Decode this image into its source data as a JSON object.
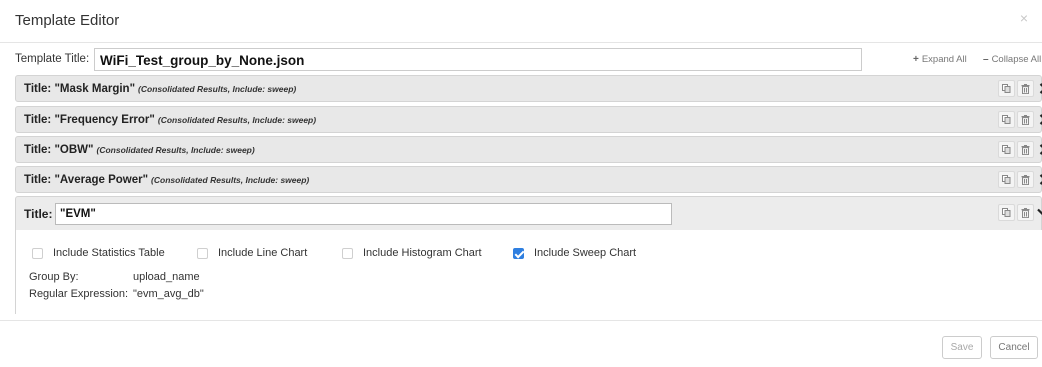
{
  "modal": {
    "title": "Template Editor",
    "close_glyph": "×"
  },
  "template_title": {
    "label": "Template Title:",
    "value": "WiFi_Test_group_by_None.json"
  },
  "toolbar": {
    "expand_all_glyph": "+",
    "expand_all": "Expand All",
    "collapse_all_glyph": "–",
    "collapse_all": "Collapse All"
  },
  "panels": [
    {
      "title_prefix": "Title: ",
      "name": "\"Mask Margin\"",
      "subtitle": "(Consolidated Results, Include: sweep)"
    },
    {
      "title_prefix": "Title: ",
      "name": "\"Frequency Error\"",
      "subtitle": "(Consolidated Results, Include: sweep)"
    },
    {
      "title_prefix": "Title: ",
      "name": "\"OBW\"",
      "subtitle": "(Consolidated Results, Include: sweep)"
    },
    {
      "title_prefix": "Title: ",
      "name": "\"Average Power\"",
      "subtitle": "(Consolidated Results, Include: sweep)"
    }
  ],
  "open_panel": {
    "title_label": "Title:",
    "title_value": "\"EVM\"",
    "checkboxes": [
      {
        "label": "Include Statistics Table",
        "checked": false
      },
      {
        "label": "Include Line Chart",
        "checked": false
      },
      {
        "label": "Include Histogram Chart",
        "checked": false
      },
      {
        "label": "Include Sweep Chart",
        "checked": true
      }
    ],
    "group_by_label": "Group By:",
    "group_by_value": "upload_name",
    "regex_label": "Regular Expression:",
    "regex_value": "\"evm_avg_db\""
  },
  "footer": {
    "save": "Save",
    "cancel": "Cancel"
  },
  "colors": {
    "panel_bg": "#e8e8e8",
    "checkbox_checked": "#2f7fe0"
  },
  "icons": [
    "copy-icon",
    "trash-icon",
    "chevron-right-icon",
    "chevron-down-icon",
    "plus-icon",
    "minus-icon",
    "close-icon"
  ]
}
